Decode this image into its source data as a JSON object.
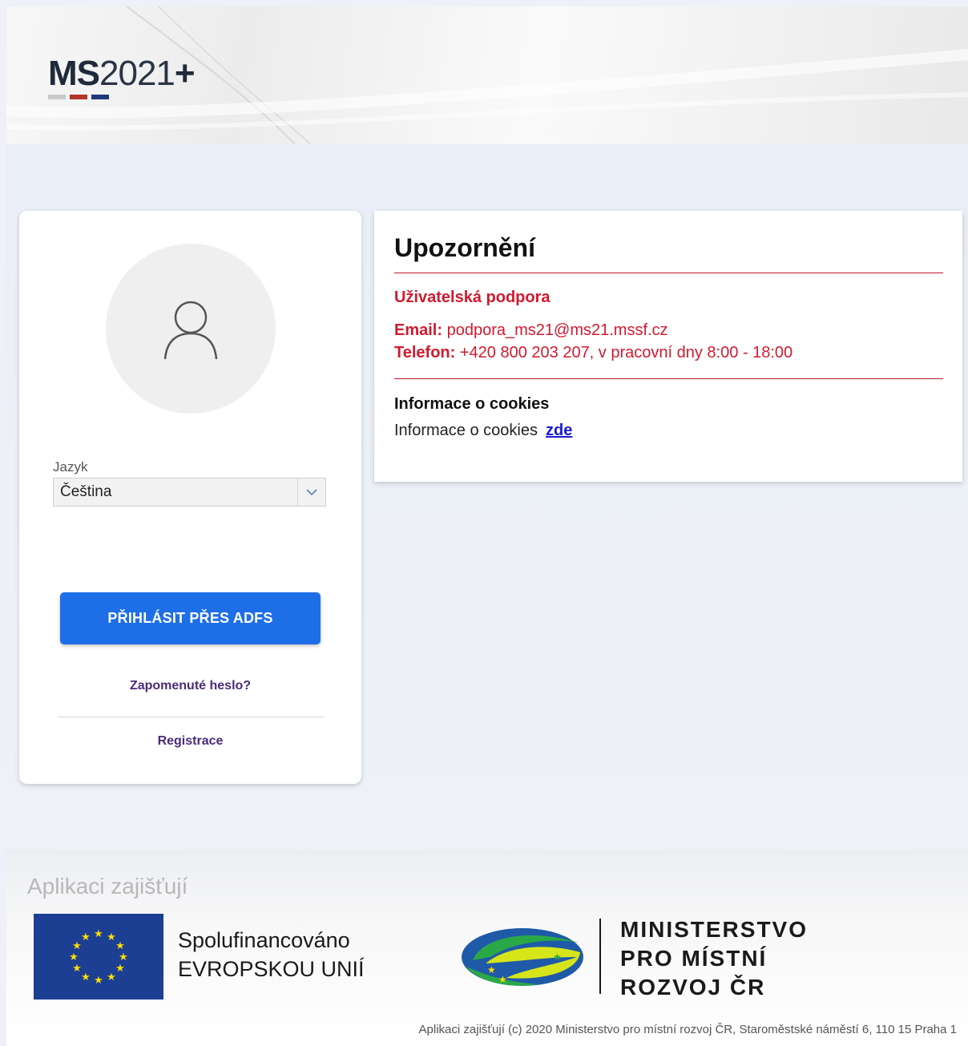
{
  "header": {
    "logo": {
      "bold": "MS",
      "thin": "2021",
      "plus": "+"
    },
    "logo_colors": [
      "#c9c9c9",
      "#b2342a",
      "#1f3a7a"
    ]
  },
  "login": {
    "avatar_icon": "user-icon",
    "language_label": "Jazyk",
    "language_value": "Čeština",
    "dropdown_icon": "chevron-down-icon",
    "login_button": "PŘIHLÁSIT PŘES ADFS",
    "forgot_password": "Zapomenuté heslo?",
    "register": "Registrace"
  },
  "notice": {
    "title": "Upozornění",
    "support_title": "Uživatelská podpora",
    "email_label": "Email:",
    "email_value": "podpora_ms21@ms21.mssf.cz",
    "phone_label": "Telefon:",
    "phone_value": "+420 800 203 207, v pracovní dny 8:00 - 18:00",
    "cookies_title": "Informace o cookies",
    "cookies_text": "Informace o cookies",
    "cookies_link": "zde"
  },
  "footer": {
    "heading": "Aplikaci zajišťují",
    "eu_line1": "Spolufinancováno",
    "eu_line2": "EVROPSKOU UNIÍ",
    "mmr_line1": "MINISTERSTVO",
    "mmr_line2": "PRO MÍSTNÍ",
    "mmr_line3": "ROZVOJ ČR",
    "copyright": "Aplikaci zajišťují (c) 2020 Ministerstvo pro místní rozvoj ČR, Staroměstské náměstí 6, 110 15 Praha 1"
  },
  "colors": {
    "accent_blue": "#1e6ee8",
    "alert_red": "#d21a2e",
    "link_purple": "#4b2a7a",
    "eu_blue": "#1c3f94",
    "eu_star": "#ffdd00"
  }
}
